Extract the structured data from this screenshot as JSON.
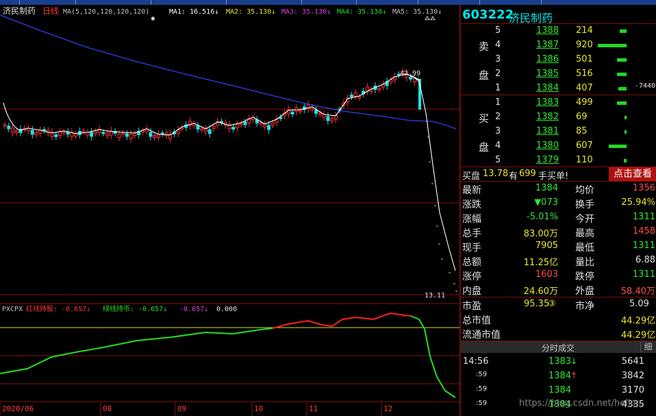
{
  "stock": {
    "code": "603222",
    "name": "济民制药",
    "period_label": "日线"
  },
  "ma_header": {
    "params": "MA(5,120,120,120,120)",
    "ma1": "MA1: 16.516↓",
    "ma2": "MA2: 35.130↓",
    "ma3": "MA3: 35.130↓",
    "ma4": "MA4: 35.130↓",
    "ma5": "MA5: 35.130↓"
  },
  "indicator_header": {
    "name": "PXCPX",
    "red_line": "红线持股: -0.657↓",
    "green_line": "绿线持币: -0.657↓",
    "third": "-0.657↓",
    "fourth": "0.000"
  },
  "price_labels": {
    "high": "42.99",
    "low": "13.11"
  },
  "x_axis": [
    "2020/06",
    "08",
    "09",
    "10",
    "11",
    "12"
  ],
  "sell_book": [
    {
      "level": "5",
      "price": "1388",
      "volume": "214"
    },
    {
      "level": "4",
      "price": "1387",
      "volume": "920"
    },
    {
      "level": "3",
      "price": "1386",
      "volume": "501"
    },
    {
      "level": "2",
      "price": "1385",
      "volume": "516"
    },
    {
      "level": "1",
      "price": "1384",
      "volume": "407"
    }
  ],
  "sell_side_labels": [
    "卖",
    "盘"
  ],
  "buy_side_labels": [
    "买",
    "盘"
  ],
  "sell_extra": "-7440",
  "buy_book": [
    {
      "level": "1",
      "price": "1383",
      "volume": "499"
    },
    {
      "level": "2",
      "price": "1382",
      "volume": "69"
    },
    {
      "level": "3",
      "price": "1381",
      "volume": "85"
    },
    {
      "level": "4",
      "price": "1380",
      "volume": "607"
    },
    {
      "level": "5",
      "price": "1379",
      "volume": "110"
    }
  ],
  "bid_notice": {
    "p1": "买盘",
    "price": "13.78",
    "p2": "有",
    "qty": "699",
    "p3": "手买单!",
    "button": "点击查看"
  },
  "stats": [
    {
      "l1": "最新",
      "v1": "1384",
      "l2": "均价",
      "v2": "1356"
    },
    {
      "l1": "涨跌",
      "v1": "▼073",
      "l2": "换手",
      "v2": "25.94%"
    },
    {
      "l1": "涨幅",
      "v1": "-5.01%",
      "l2": "今开",
      "v2": "1311"
    },
    {
      "l1": "总手",
      "v1": "83.00万",
      "l2": "最高",
      "v2": "1458"
    },
    {
      "l1": "现手",
      "v1": "7905",
      "l2": "最低",
      "v2": "1311"
    },
    {
      "l1": "总额",
      "v1": "11.25亿",
      "l2": "量比",
      "v2": "6.88"
    },
    {
      "l1": "涨停",
      "v1": "1603",
      "l2": "跌停",
      "v2": "1311"
    },
    {
      "l1": "内盘",
      "v1": "24.60万",
      "l2": "外盘",
      "v2": "58.40万"
    }
  ],
  "valuation": [
    {
      "l1": "市盈",
      "v1": "95.35",
      "badge": "③",
      "l2": "市净",
      "v2": "5.09"
    },
    {
      "l1": "总市值",
      "v1": "44.29亿"
    },
    {
      "l1": "流通市值",
      "v1": "44.29亿"
    }
  ],
  "ticks": {
    "title": "分时成交",
    "tab": "细",
    "rows": [
      {
        "time": "14:56",
        "price": "1383",
        "arrow": "↓",
        "vol": "5641"
      },
      {
        "time": ":59",
        "price": "1384",
        "arrow": "↑",
        "vol": "3842"
      },
      {
        "time": ":59",
        "price": "1384",
        "arrow": "",
        "vol": "3170"
      },
      {
        "time": ":59",
        "price": "1384",
        "arrow": "",
        "vol": "4335"
      }
    ]
  },
  "watermark": "https://blog.csdn.net/hello...",
  "colors": {
    "up": "#ff3030",
    "down": "#22e0e0",
    "ma_short": "#ffffff",
    "ma_long": "#2f3fe8",
    "bar": "#22d822",
    "grid": "#8b1010"
  }
}
